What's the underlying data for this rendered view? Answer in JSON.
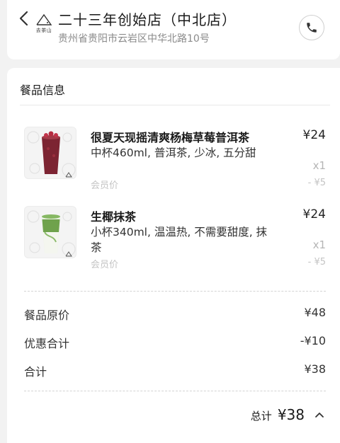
{
  "header": {
    "logo_text": "去茶山",
    "store_name": "二十三年创始店（中北店）",
    "address": "贵州省贵阳市云岩区中华北路10号"
  },
  "order": {
    "section_title": "餐品信息",
    "items": [
      {
        "name": "很夏天现摇清爽杨梅草莓普洱茶",
        "spec": "中杯460ml, 普洱茶, 少冰, 五分甜",
        "member_label": "会员价",
        "price": "¥24",
        "qty": "x1",
        "discount": "- ¥5"
      },
      {
        "name": "生椰抹茶",
        "spec": "小杯340ml, 温温热, 不需要甜度, 抹茶",
        "member_label": "会员价",
        "price": "¥24",
        "qty": "x1",
        "discount": "- ¥5"
      }
    ],
    "summary": {
      "original_label": "餐品原价",
      "original_value": "¥48",
      "discount_label": "优惠合计",
      "discount_value": "-¥10",
      "subtotal_label": "合计",
      "subtotal_value": "¥38"
    },
    "total": {
      "label": "总计",
      "value": "¥38"
    }
  },
  "icons": {
    "back": "chevron-left-icon",
    "phone": "phone-icon",
    "expand": "chevron-up-icon"
  },
  "colors": {
    "drink1": "#8b2a35",
    "drink2": "#7fae58"
  }
}
